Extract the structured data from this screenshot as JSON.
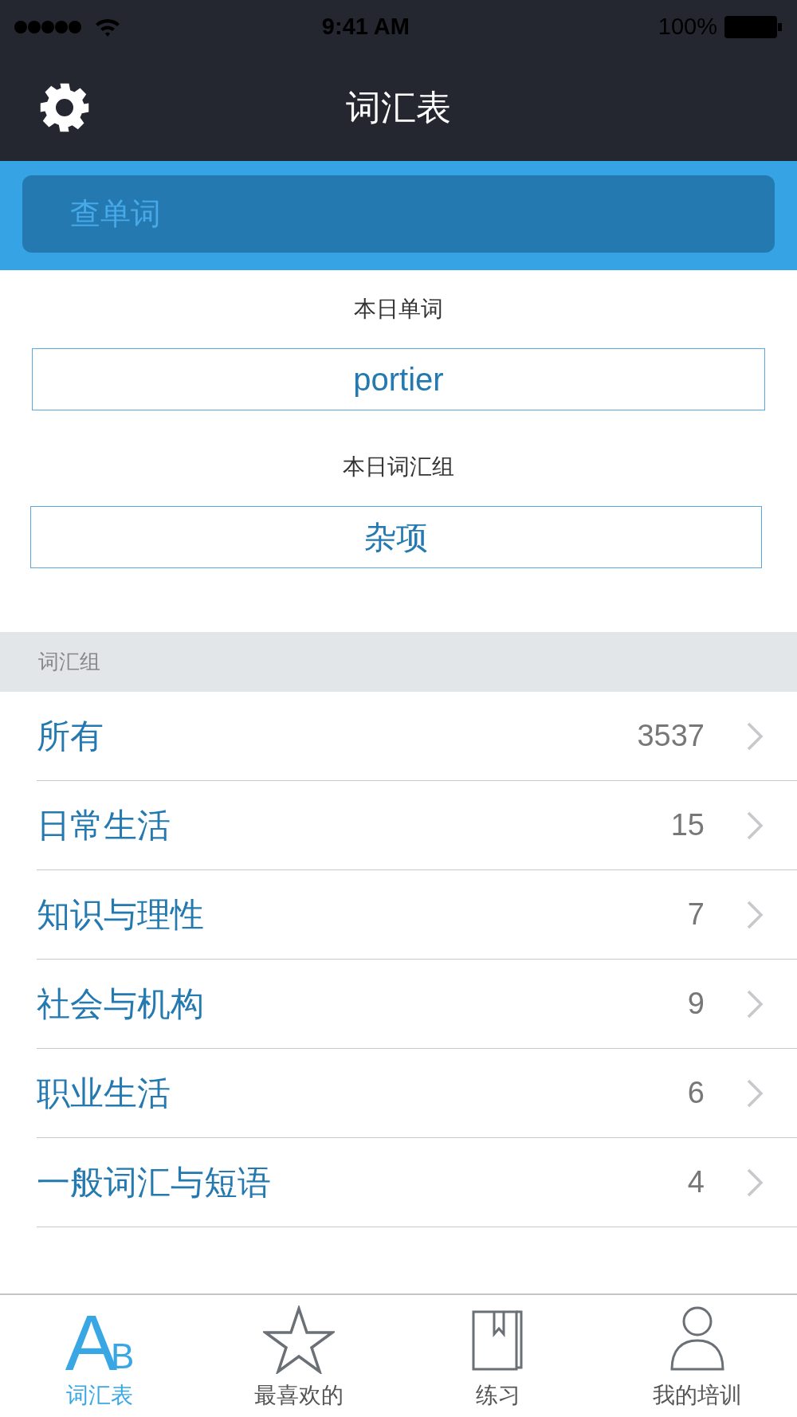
{
  "status_bar": {
    "time": "9:41 AM",
    "battery": "100%"
  },
  "nav": {
    "title": "词汇表"
  },
  "search": {
    "placeholder": "查单词"
  },
  "daily": [
    {
      "label": "本日单词",
      "value": "portier"
    },
    {
      "label": "本日词汇组",
      "value": "杂项"
    }
  ],
  "section": {
    "title": "词汇组"
  },
  "groups": [
    {
      "name": "所有",
      "count": "3537"
    },
    {
      "name": "日常生活",
      "count": "15"
    },
    {
      "name": "知识与理性",
      "count": "7"
    },
    {
      "name": "社会与机构",
      "count": "9"
    },
    {
      "name": "职业生活",
      "count": "6"
    },
    {
      "name": "一般词汇与短语",
      "count": "4"
    }
  ],
  "tabs": [
    {
      "label": "词汇表",
      "kind": "letters",
      "glyph_large": "A",
      "glyph_small": "B",
      "selected": true
    },
    {
      "label": "最喜欢的",
      "kind": "star",
      "selected": false
    },
    {
      "label": "练习",
      "kind": "book",
      "selected": false
    },
    {
      "label": "我的培训",
      "kind": "person",
      "selected": false
    }
  ]
}
